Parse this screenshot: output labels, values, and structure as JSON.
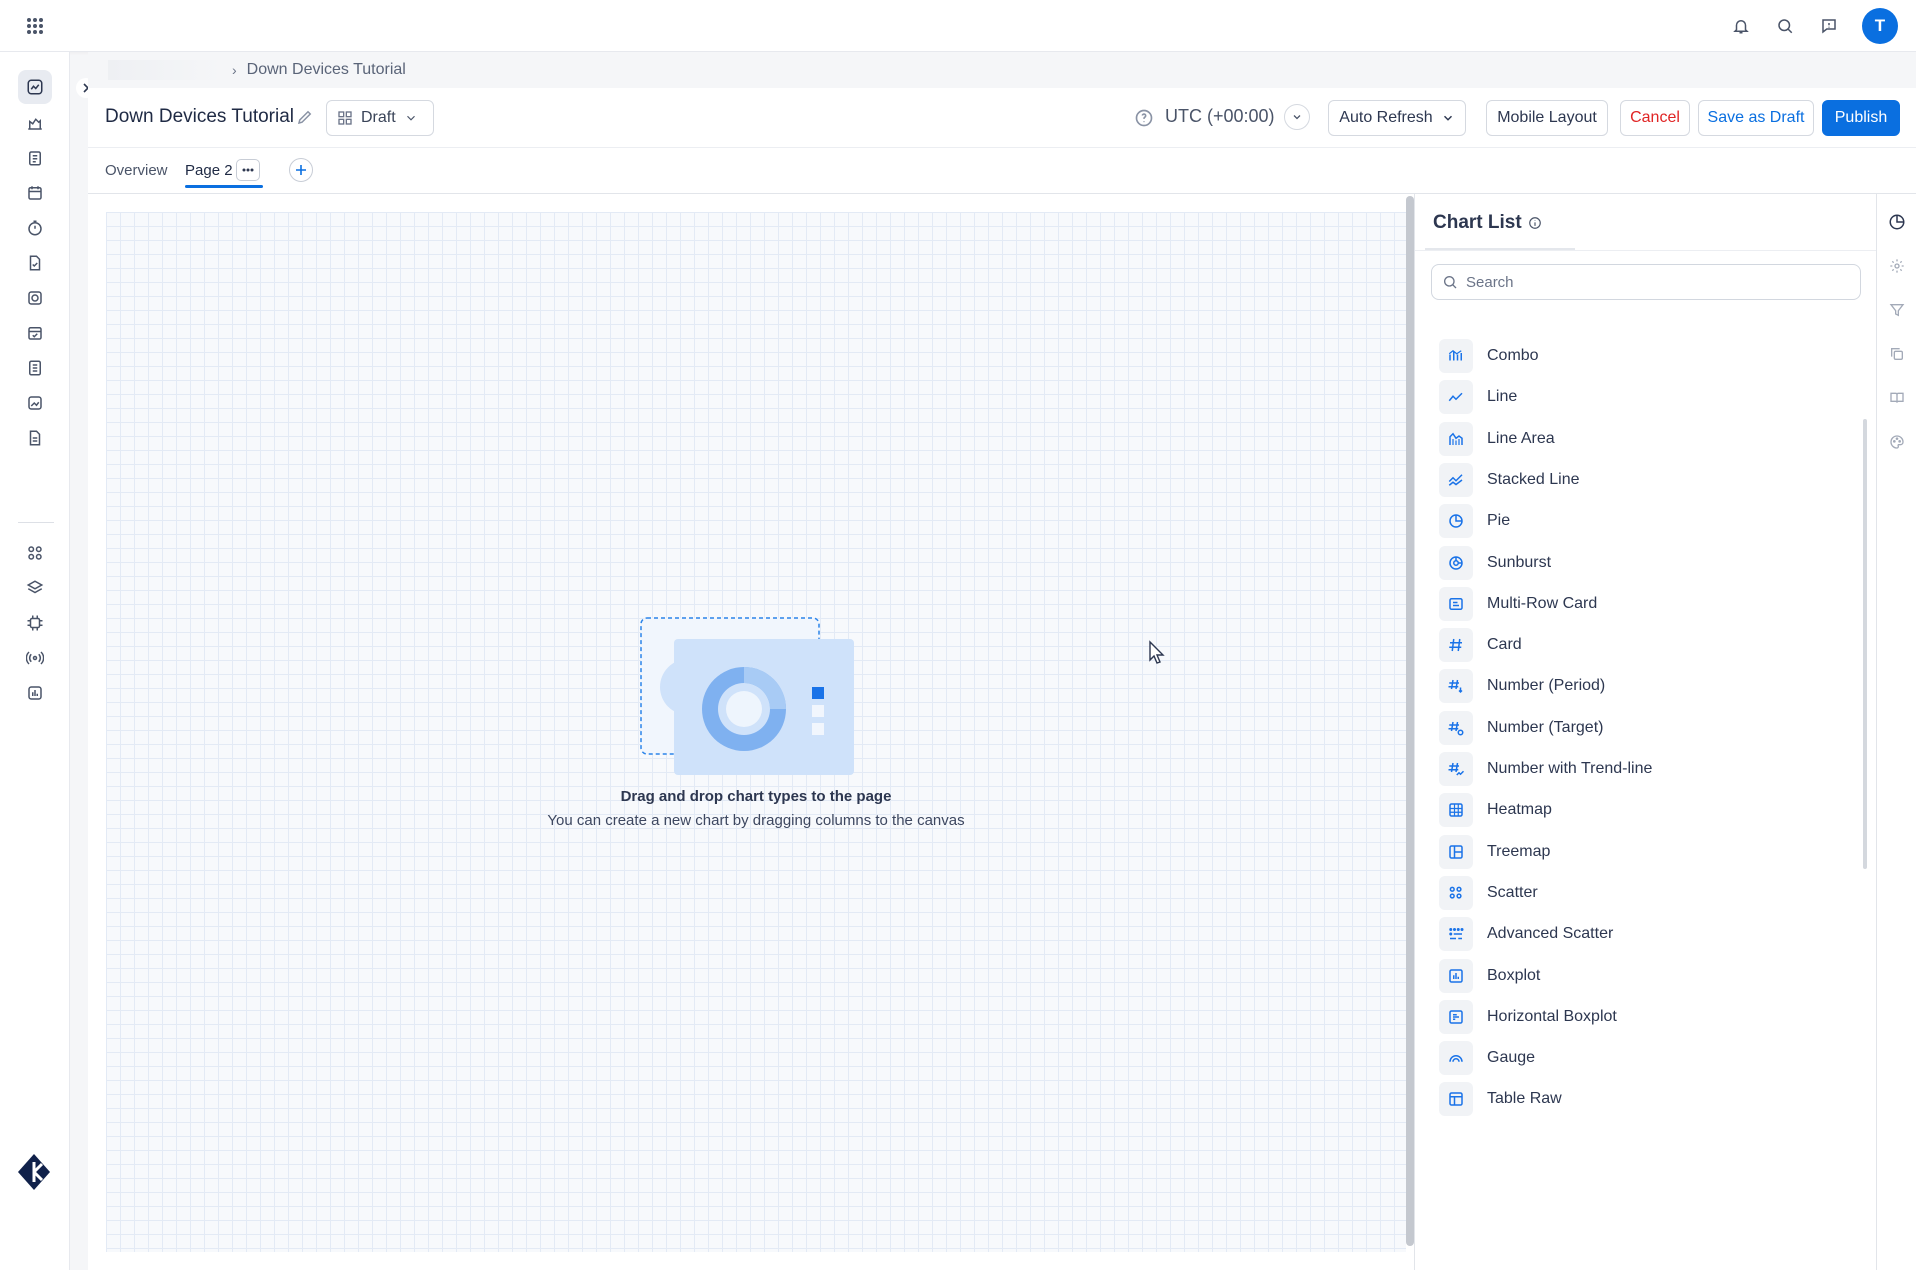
{
  "topbar": {
    "apps_icon": "apps-grid-icon",
    "icons": [
      "bell-icon",
      "search-icon",
      "help-chat-icon"
    ],
    "avatar_initial": "T"
  },
  "sidebar": {
    "items": [
      {
        "icon": "dashboard-icon",
        "active": true
      },
      {
        "icon": "map-icon"
      },
      {
        "icon": "clipboard-icon"
      },
      {
        "icon": "calendar-icon"
      },
      {
        "icon": "timer-icon"
      },
      {
        "icon": "document-check-icon"
      },
      {
        "icon": "target-icon"
      },
      {
        "icon": "calendar-check-icon"
      },
      {
        "icon": "list-icon"
      },
      {
        "icon": "chart-image-icon"
      },
      {
        "icon": "report-icon"
      },
      {
        "icon": "apps-icon"
      },
      {
        "icon": "layers-icon"
      },
      {
        "icon": "cpu-icon"
      },
      {
        "icon": "broadcast-icon"
      },
      {
        "icon": "bar-chart-icon"
      }
    ]
  },
  "breadcrumb": {
    "current": "Down Devices Tutorial"
  },
  "header": {
    "title": "Down Devices Tutorial",
    "status": "Draft",
    "timezone": "UTC (+00:00)",
    "auto_refresh": "Auto Refresh",
    "mobile_layout": "Mobile Layout",
    "cancel": "Cancel",
    "save_draft": "Save as Draft",
    "publish": "Publish"
  },
  "tabs": [
    {
      "label": "Overview"
    },
    {
      "label": "Page 2",
      "active": true
    }
  ],
  "canvas": {
    "empty_title": "Drag and drop chart types to the page",
    "empty_subtitle": "You can create a new chart by dragging columns to the canvas"
  },
  "panel": {
    "title": "Chart List",
    "search_placeholder": "Search",
    "items": [
      {
        "label": "Combo",
        "icon": "combo-chart-icon"
      },
      {
        "label": "Line",
        "icon": "line-chart-icon"
      },
      {
        "label": "Line Area",
        "icon": "line-area-icon"
      },
      {
        "label": "Stacked Line",
        "icon": "stacked-line-icon"
      },
      {
        "label": "Pie",
        "icon": "pie-chart-icon"
      },
      {
        "label": "Sunburst",
        "icon": "sunburst-icon"
      },
      {
        "label": "Multi-Row Card",
        "icon": "multi-row-card-icon"
      },
      {
        "label": "Card",
        "icon": "hash-icon"
      },
      {
        "label": "Number (Period)",
        "icon": "number-period-icon"
      },
      {
        "label": "Number (Target)",
        "icon": "number-target-icon"
      },
      {
        "label": "Number with Trend-line",
        "icon": "number-trend-icon"
      },
      {
        "label": "Heatmap",
        "icon": "heatmap-icon"
      },
      {
        "label": "Treemap",
        "icon": "treemap-icon"
      },
      {
        "label": "Scatter",
        "icon": "scatter-icon"
      },
      {
        "label": "Advanced Scatter",
        "icon": "advanced-scatter-icon"
      },
      {
        "label": "Boxplot",
        "icon": "boxplot-icon"
      },
      {
        "label": "Horizontal Boxplot",
        "icon": "horizontal-boxplot-icon"
      },
      {
        "label": "Gauge",
        "icon": "gauge-icon"
      },
      {
        "label": "Table Raw",
        "icon": "table-icon"
      }
    ]
  },
  "right_rail": {
    "icons": [
      "chart-pie-icon",
      "settings-icon",
      "filter-icon",
      "copy-icon",
      "book-icon",
      "palette-icon"
    ]
  },
  "colors": {
    "accent": "#0a6fe0",
    "danger": "#e02424",
    "icon_blue": "#1a73e8"
  }
}
